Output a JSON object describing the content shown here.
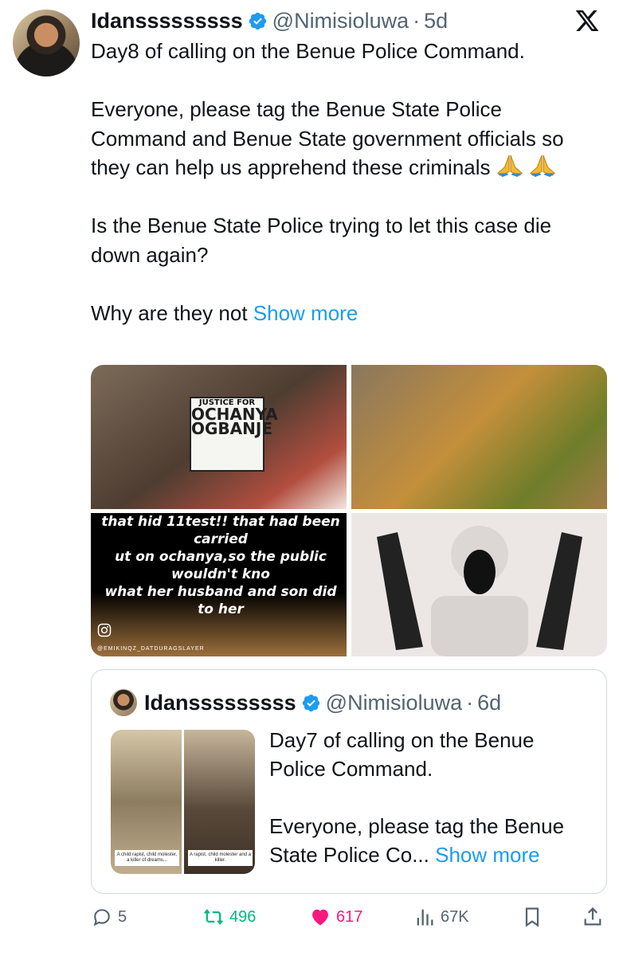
{
  "tweet": {
    "author_name": "Idansssssssss",
    "handle": "@Nimisioluwa",
    "separator": "·",
    "time": "5d",
    "text_lines": [
      "Day8 of calling on the Benue Police Command.",
      "Everyone, please tag the Benue State Police Command and Benue State government officials so they can help us apprehend these criminals",
      "Is the Benue State Police trying to let this case die down again?",
      "Why are they not"
    ],
    "show_more": "Show more"
  },
  "media": {
    "justice_label_top": "JUSTICE FOR",
    "justice_label_mid": "OCHANYA",
    "justice_label_bottom": "OGBANJE",
    "caption_lines": [
      "that hid 11test!! that had been carried",
      "ut on ochanya,so the public wouldn't kno",
      "what her husband and son did to her"
    ],
    "watermark": "@EMIKINQZ_DATDURAGSLAYER"
  },
  "quoted_tweet": {
    "author_name": "Idansssssssss",
    "handle": "@Nimisioluwa",
    "separator": "·",
    "time": "6d",
    "caption_left": "A child rapist, child molester, a killer of dreams...",
    "caption_right": "A rapist, child molester and a killer.",
    "text_line1": "Day7 of calling on the Benue Police Command.",
    "text_line2": "Everyone, please tag the Benue State Police Co...",
    "show_more": "Show more"
  },
  "actions": {
    "replies": "5",
    "retweets": "496",
    "likes": "617",
    "views": "67K"
  },
  "colors": {
    "link": "#1d9bf0",
    "verified": "#1d9bf0",
    "retweet": "#00ba7c",
    "like": "#f91880",
    "muted": "#536471"
  },
  "icons": [
    "verified-badge-icon",
    "x-logo-icon",
    "folded-hands-icon",
    "instagram-icon",
    "reply-icon",
    "retweet-icon",
    "heart-icon",
    "views-icon",
    "bookmark-icon",
    "share-icon"
  ]
}
